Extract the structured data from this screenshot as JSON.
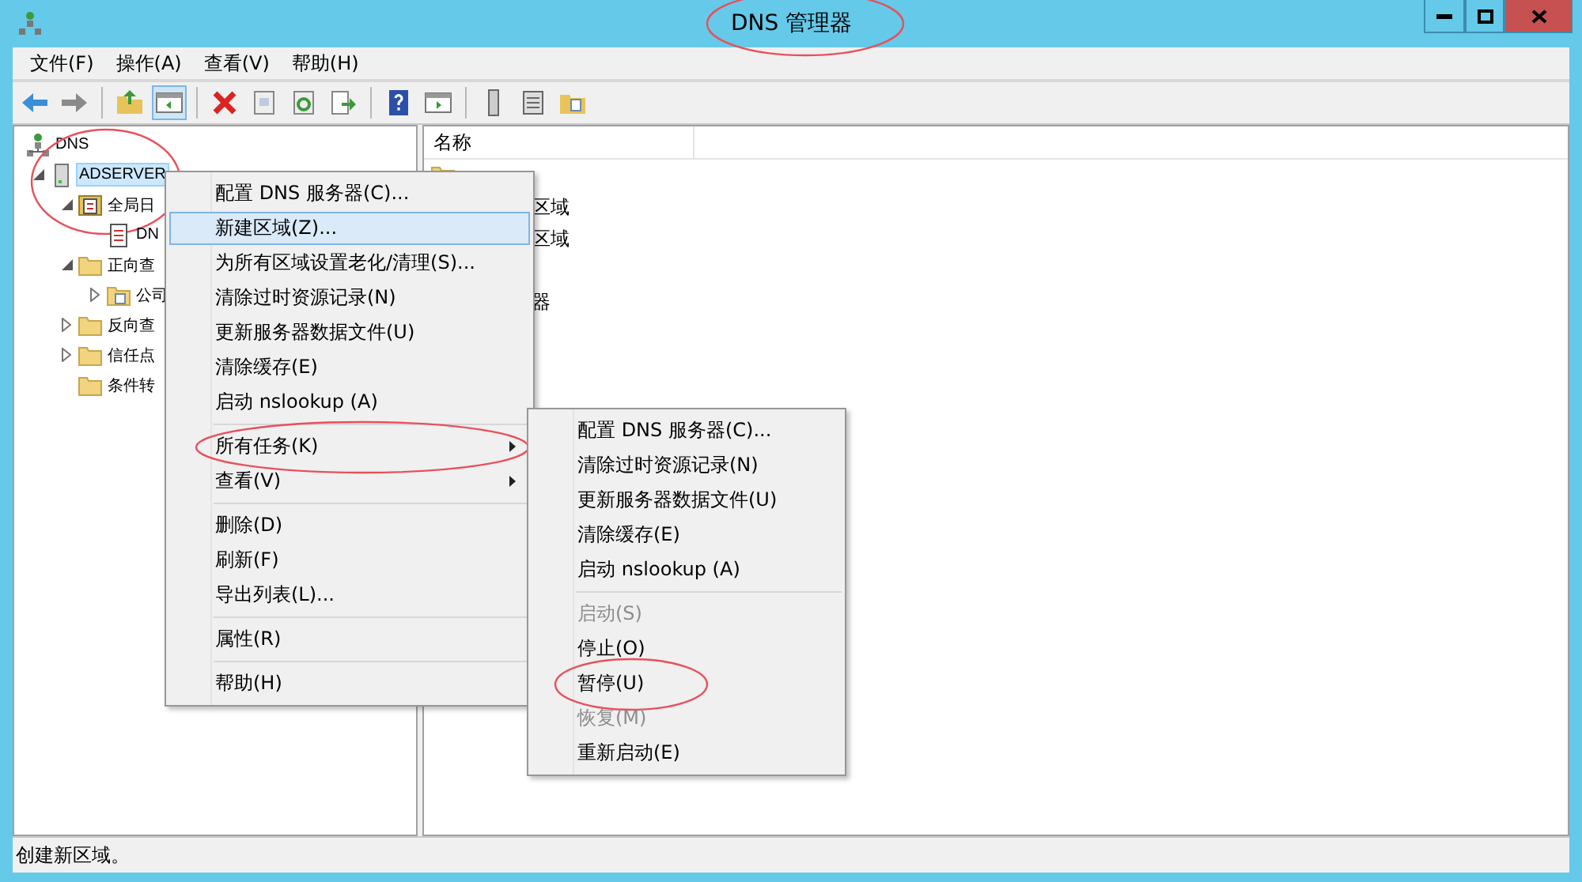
{
  "window": {
    "title": "DNS 管理器",
    "title_circled": true
  },
  "menu_bar": [
    {
      "label": "文件(F)"
    },
    {
      "label": "操作(A)"
    },
    {
      "label": "查看(V)"
    },
    {
      "label": "帮助(H)"
    }
  ],
  "toolbar": [
    {
      "kind": "back",
      "pressed": false
    },
    {
      "kind": "forward",
      "pressed": false
    },
    {
      "kind": "separator"
    },
    {
      "kind": "up",
      "pressed": false
    },
    {
      "kind": "tree-pane",
      "pressed": true
    },
    {
      "kind": "separator"
    },
    {
      "kind": "delete",
      "pressed": false
    },
    {
      "kind": "properties",
      "pressed": false
    },
    {
      "kind": "refresh",
      "pressed": false
    },
    {
      "kind": "export",
      "pressed": false
    },
    {
      "kind": "separator"
    },
    {
      "kind": "help",
      "pressed": false
    },
    {
      "kind": "action-pane",
      "pressed": false
    },
    {
      "kind": "separator"
    },
    {
      "kind": "server",
      "pressed": false
    },
    {
      "kind": "list",
      "pressed": false
    },
    {
      "kind": "folders",
      "pressed": false
    }
  ],
  "tree": [
    {
      "label": "DNS",
      "kind": "dns",
      "selected": false,
      "children": [
        {
          "label": "ADSERVER",
          "kind": "server",
          "expanded": true,
          "selected": true,
          "circled": true,
          "children": [
            {
              "label": "全局日",
              "kind": "log",
              "expanded": true,
              "selected": false,
              "children": [
                {
                  "label": "DN",
                  "kind": "log-file",
                  "selected": false
                }
              ]
            },
            {
              "label": "正向查",
              "kind": "folder",
              "expanded": true,
              "selected": false,
              "children": [
                {
                  "label": "公司",
                  "kind": "zone",
                  "expanded": false,
                  "selected": false
                }
              ]
            },
            {
              "label": "反向查",
              "kind": "folder",
              "expanded": false,
              "selected": false
            },
            {
              "label": "信任点",
              "kind": "folder",
              "expanded": false,
              "selected": false
            },
            {
              "label": "条件转",
              "kind": "folder",
              "selected": false
            }
          ]
        }
      ]
    }
  ],
  "list": {
    "columns": [
      {
        "label": "名称"
      }
    ],
    "rows": [
      {
        "kind": "folder"
      },
      {
        "label": "区域"
      },
      {
        "label": "区域"
      },
      {},
      {
        "label": "器"
      }
    ]
  },
  "context_menu": {
    "items": [
      {
        "kind": "item",
        "label": "配置 DNS 服务器(C)...",
        "selected": false,
        "disabled": false
      },
      {
        "kind": "item",
        "label": "新建区域(Z)...",
        "selected": true,
        "disabled": false
      },
      {
        "kind": "item",
        "label": "为所有区域设置老化/清理(S)...",
        "selected": false,
        "disabled": false
      },
      {
        "kind": "item",
        "label": "清除过时资源记录(N)",
        "selected": false,
        "disabled": false
      },
      {
        "kind": "item",
        "label": "更新服务器数据文件(U)",
        "selected": false,
        "disabled": false
      },
      {
        "kind": "item",
        "label": "清除缓存(E)",
        "selected": false,
        "disabled": false
      },
      {
        "kind": "item",
        "label": "启动 nslookup (A)",
        "selected": false,
        "disabled": false
      },
      {
        "kind": "separator"
      },
      {
        "kind": "item",
        "label": "所有任务(K)",
        "selected": false,
        "disabled": false,
        "submenu": true,
        "circled": true
      },
      {
        "kind": "item",
        "label": "查看(V)",
        "selected": false,
        "disabled": false,
        "submenu": true
      },
      {
        "kind": "separator"
      },
      {
        "kind": "item",
        "label": "删除(D)",
        "selected": false,
        "disabled": false
      },
      {
        "kind": "item",
        "label": "刷新(F)",
        "selected": false,
        "disabled": false
      },
      {
        "kind": "item",
        "label": "导出列表(L)...",
        "selected": false,
        "disabled": false
      },
      {
        "kind": "separator"
      },
      {
        "kind": "item",
        "label": "属性(R)",
        "selected": false,
        "disabled": false
      },
      {
        "kind": "separator"
      },
      {
        "kind": "item",
        "label": "帮助(H)",
        "selected": false,
        "disabled": false
      }
    ]
  },
  "submenu": {
    "items": [
      {
        "kind": "item",
        "label": "配置 DNS 服务器(C)...",
        "selected": false,
        "disabled": false
      },
      {
        "kind": "item",
        "label": "清除过时资源记录(N)",
        "selected": false,
        "disabled": false
      },
      {
        "kind": "item",
        "label": "更新服务器数据文件(U)",
        "selected": false,
        "disabled": false
      },
      {
        "kind": "item",
        "label": "清除缓存(E)",
        "selected": false,
        "disabled": false
      },
      {
        "kind": "item",
        "label": "启动 nslookup (A)",
        "selected": false,
        "disabled": false
      },
      {
        "kind": "separator"
      },
      {
        "kind": "item",
        "label": "启动(S)",
        "selected": false,
        "disabled": true
      },
      {
        "kind": "item",
        "label": "停止(O)",
        "selected": false,
        "disabled": false
      },
      {
        "kind": "item",
        "label": "暂停(U)",
        "selected": false,
        "disabled": false,
        "circled": true
      },
      {
        "kind": "item",
        "label": "恢复(M)",
        "selected": false,
        "disabled": true
      },
      {
        "kind": "item",
        "label": "重新启动(E)",
        "selected": false,
        "disabled": false
      }
    ]
  },
  "status_bar": {
    "text": "创建新区域。"
  }
}
